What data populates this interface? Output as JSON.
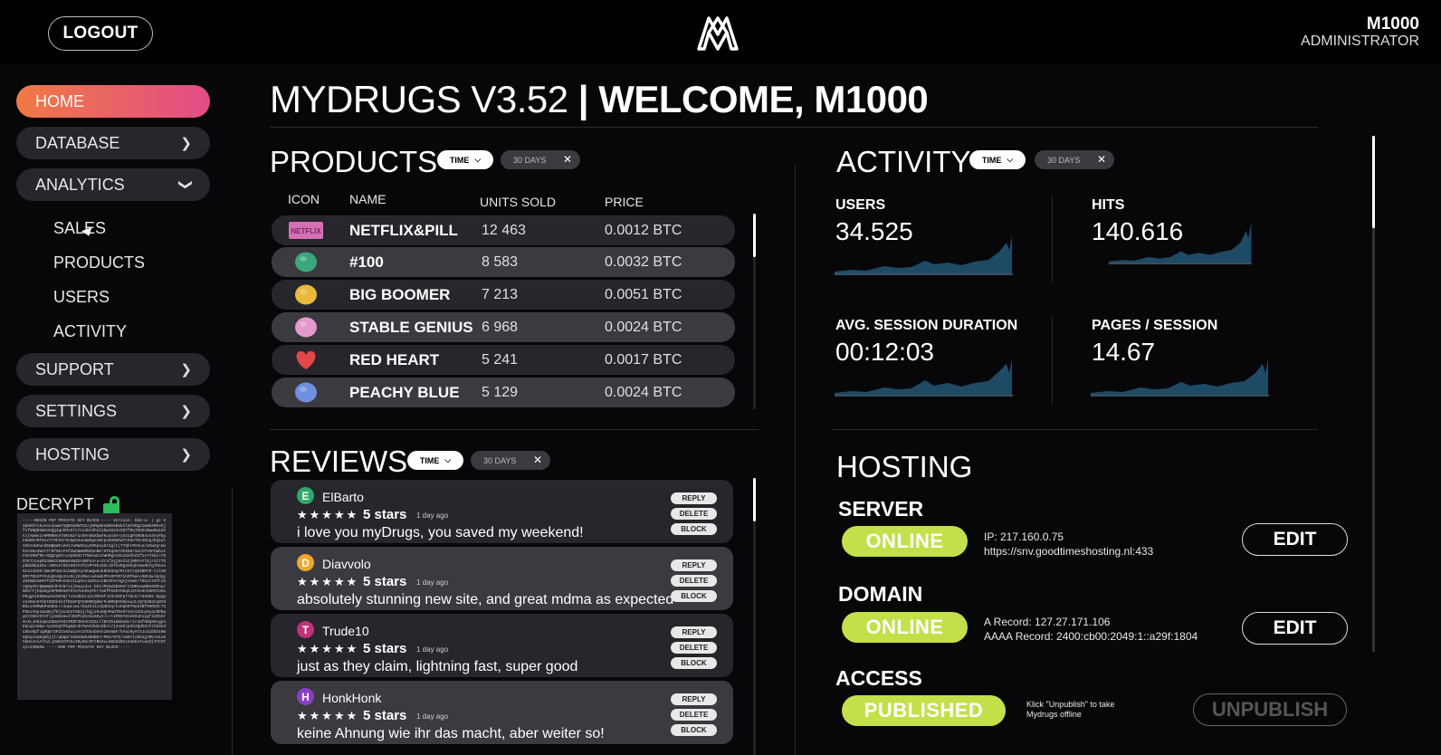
{
  "header": {
    "logout_label": "LOGOUT",
    "logo": "mydrugs-logo",
    "user_name": "M1000",
    "user_role": "ADMINISTRATOR"
  },
  "sidebar": {
    "items": [
      {
        "label": "HOME",
        "active": true
      },
      {
        "label": "DATABASE",
        "icon": "chevron-right-icon"
      },
      {
        "label": "ANALYTICS",
        "icon": "chevron-down-icon",
        "expanded": true
      },
      {
        "label": "SUPPORT",
        "icon": "chevron-right-icon"
      },
      {
        "label": "SETTINGS",
        "icon": "chevron-right-icon"
      },
      {
        "label": "HOSTING",
        "icon": "chevron-right-icon"
      }
    ],
    "sub_items": [
      "SALES",
      "PRODUCTS",
      "USERS",
      "ACTIVITY"
    ],
    "decrypt": {
      "title": "DECRYPT",
      "icon": "unlocked-lock-icon",
      "pgp_block": "-----BEGIN PGP PRIVATE KEY BLOCK----- Version: bb4-a- | gz HmdAKb7xkuAAs1UwW7aQBCWdWTU1sjWMq0Ea8Re6DUkhl5FOOg11mWa300vEjfsf9NQ0GWA3sQgIgnhMxHlt7zo4ktOh1Cibw1023xS9TfMqTRXEcBwwNu1ZVkzjAmWn1vHM0N0ovTOKVm2+1n5Fnm5XbwFKoaxSA+yG41gPxRDN4un3eyPQuCUwKEvRF8xxTr0FZ4r5CmpnSxLWw5gxsBcpsOUNmhwTchmeTbs4DugJkg1wlISknAmCwcbEWQmWIseH1JvHWSUyyXDKpeybz1gltjT7QhrMz5ue/UIw2g+WuKAV1Bx3WerFrNfSEzF5fZwCWW6MNCDoNK+HTbqb67dkSNHrm4JzFVXFCWbxIFUAIRNfRG+6QQCgHd+yVpObKCTTBeFwCxtWHMgVx5Cu5UhhZ2f1sYYSGi+tRGTKTz1epR230WIC9WKWAVBd2YqMPX4+u+Zr1f24j9sCSIjNMYVYlDjr4iTTbpd6UbEaIDu-2HRsetRZ1KRzhtPiVPY0hsDZcJDfkvMg4HGqhYWuRbTg7E5ve9I4JiKSD/aBu9P4WcSLbWQDzqz0UwQwdukNhb9Aq7KrCZtYqHIBRTR-t1lnMDMY7DbIPYhdxQXoQa1VsOLjSiMKA/wSuWkPPoSPYR7ihMfKW+e3BtUwl6dqyd49mEb4mRYfdIPHOnnHGzIuq5nvlW3S4JzBG3F8rHgAjHnWA/T9GJzt8fFybzQ5qYDrQBwWQhdFdzB/xnj0aqJdxn-b5IJPGmxbb5HerYiNRuVwHBn8d9nw/NkkrFjOq5GgxHPRHE9ZYhVuTUe8VyPkrTwGfPS2EYH8qGJXtHx0nSHRVI3OxPEqghiD5BewdvbXKhQrlsGuObGL1CC3MkHfJzUcH6Fp7T8L6/r8eH01-Dgqpv1eEUoHYbEtRZDkkkIfBSUFQTGHNRKQdWrPu0R5NYbKkvwJLzQrEUN3zqNtNBSLxANOW5PuGB4L+c4uwLxwL+bq4C4ixzQ3E5q/CvHqh0T5wkIBf5HOUXcT2PSExA5pxmcBUjfDj3u3dvT8D3j/bgjJHuOQnPwDTRAHT4Vv1X9LpmsaLRPBqgVzCK0zStATlyXm61mv3lEUP1d2sGLKEyA/L++1PK97Zne6XoEoygfiUCbHrm+ZLJHG2qmoZSNoF6dzOMZF3EkACCE6L7lBYZh1mbbaOv+tc4UfONq8Kvgp4EUcq2Jm5w-Ayk6nQTPkgm8c3HTwVCOHUz0brLYjZx8ElpkbzQdhOzFzCb9k3CDbsRpfJgRQErSP2Ix6AuLxVsIYDUsbHAn1Rn6mF/kFwcNyAT4JcGiDbhIHWOpbqn1m6aDbjJl/qNqmrtEDe0W54KHBbYrPN2rM7k/v6KTlcKDJg7MG+U1xK5bHxvCiAfAvLjOmG1tRY5xI0ySUc0TzBUZuLHGD3d0Cv3aEExYLwXZiTYCSTqzvJXB6Om -----END PGP PRIVATE KEY BLOCK-----"
    }
  },
  "headline": {
    "app": "MYDRUGS V3.52",
    "separator": "|",
    "welcome": "WELCOME, M1000"
  },
  "filters": {
    "time_label": "TIME",
    "range_label": "30 DAYS"
  },
  "products": {
    "title": "PRODUCTS",
    "columns": [
      "ICON",
      "NAME",
      "UNITS SOLD",
      "PRICE"
    ],
    "rows": [
      {
        "icon": "netflix-pill-icon",
        "name": "NETFLIX&PILL",
        "units": "12 463",
        "price": "0.0012 BTC",
        "color": "#d670b4"
      },
      {
        "icon": "green-pill-icon",
        "name": "#100",
        "units": "8 583",
        "price": "0.0032 BTC",
        "color": "#3aa77d"
      },
      {
        "icon": "yellow-pill-icon",
        "name": "BIG BOOMER",
        "units": "7 213",
        "price": "0.0051 BTC",
        "color": "#e9b93a"
      },
      {
        "icon": "pink-pill-icon",
        "name": "STABLE GENIUS",
        "units": "6 968",
        "price": "0.0024 BTC",
        "color": "#e39acb"
      },
      {
        "icon": "red-heart-pill-icon",
        "name": "RED HEART",
        "units": "5 241",
        "price": "0.0017 BTC",
        "color": "#e24848"
      },
      {
        "icon": "blue-pill-icon",
        "name": "PEACHY BLUE",
        "units": "5 129",
        "price": "0.0024 BTC",
        "color": "#6f8fe0"
      }
    ]
  },
  "reviews": {
    "title": "REVIEWS",
    "buttons": {
      "reply": "REPLY",
      "delete": "DELETE",
      "block": "BLOCK"
    },
    "items": [
      {
        "initial": "E",
        "author": "ElBarto",
        "stars": "★★★★★",
        "rating": "5 stars",
        "age": "1 day ago",
        "text": "i love you myDrugs, you saved my weekend!",
        "avatar_color": "#2fa86b"
      },
      {
        "initial": "D",
        "author": "Diavvolo",
        "stars": "★★★★★",
        "rating": "5 stars",
        "age": "1 day ago",
        "text": "absolutely stunning new site, and great mdma as expected",
        "avatar_color": "#f0a82a"
      },
      {
        "initial": "T",
        "author": "Trude10",
        "stars": "★★★★★",
        "rating": "5 stars",
        "age": "1 day ago",
        "text": "just as they claim, lightning fast, super good",
        "avatar_color": "#c2327a"
      },
      {
        "initial": "H",
        "author": "HonkHonk",
        "stars": "★★★★★",
        "rating": "5 stars",
        "age": "1 day ago",
        "text": "keine Ahnung wie ihr das macht, aber weiter so!",
        "avatar_color": "#8a3fc4"
      }
    ]
  },
  "activity": {
    "title": "ACTIVITY",
    "stats": [
      {
        "label": "USERS",
        "value": "34.525"
      },
      {
        "label": "HITS",
        "value": "140.616"
      },
      {
        "label": "AVG. SESSION DURATION",
        "value": "00:12:03"
      },
      {
        "label": "PAGES / SESSION",
        "value": "14.67"
      }
    ],
    "spark_color": "#1f4a66"
  },
  "hosting": {
    "title": "HOSTING",
    "server": {
      "label": "SERVER",
      "status": "ONLINE",
      "line1": "IP: 217.160.0.75",
      "line2": "https://snv.goodtimeshosting.nl:433",
      "button": "EDIT"
    },
    "domain": {
      "label": "DOMAIN",
      "status": "ONLINE",
      "line1": "A Record: 127.27.171.106",
      "line2": "AAAA Record: 2400:cb00:2049:1::a29f:1804",
      "button": "EDIT"
    },
    "access": {
      "label": "ACCESS",
      "status": "PUBLISHED",
      "note": "Klick \"Unpublish\" to take Mydrugs offline",
      "button": "UNPUBLISH"
    },
    "status_color": "#c2e04a"
  }
}
